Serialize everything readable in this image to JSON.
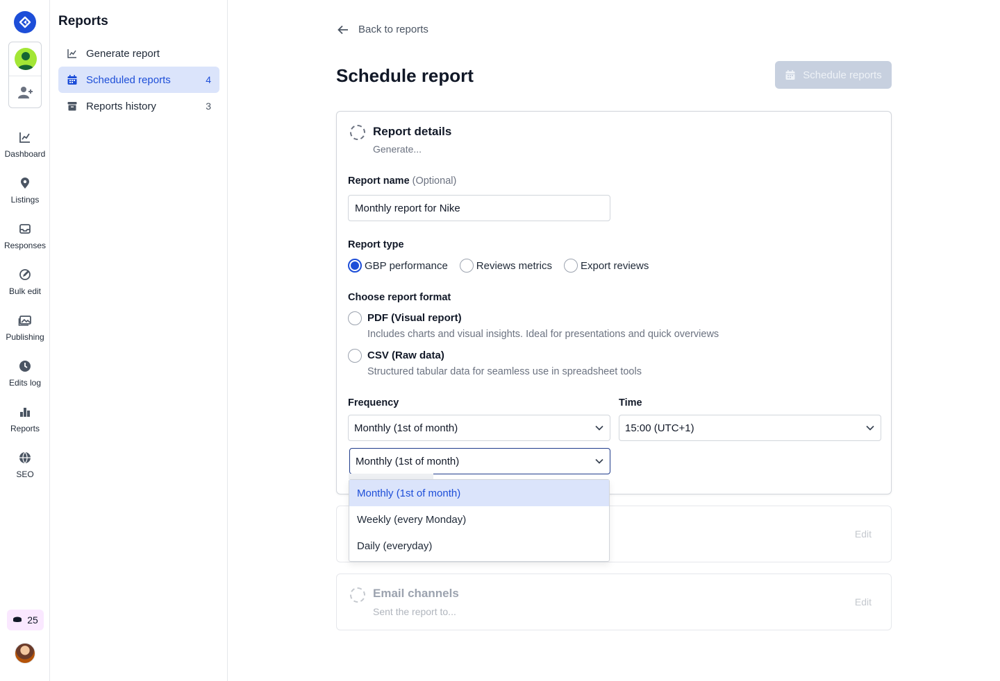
{
  "rail": {
    "items": [
      {
        "label": "Dashboard",
        "icon": "chart-line-icon"
      },
      {
        "label": "Listings",
        "icon": "map-pin-icon"
      },
      {
        "label": "Responses",
        "icon": "inbox-icon"
      },
      {
        "label": "Bulk edit",
        "icon": "edit-circle-icon"
      },
      {
        "label": "Publishing",
        "icon": "images-icon"
      },
      {
        "label": "Edits log",
        "icon": "clock-icon"
      },
      {
        "label": "Reports",
        "icon": "bar-chart-icon"
      },
      {
        "label": "SEO",
        "icon": "globe-icon"
      }
    ],
    "credits": "25"
  },
  "subnav": {
    "title": "Reports",
    "items": [
      {
        "label": "Generate report",
        "count": "",
        "icon": "chart-line-icon"
      },
      {
        "label": "Scheduled reports",
        "count": "4",
        "icon": "calendar-icon"
      },
      {
        "label": "Reports history",
        "count": "3",
        "icon": "archive-icon"
      }
    ]
  },
  "header": {
    "back_label": "Back to reports",
    "title": "Schedule report",
    "schedule_button": "Schedule reports"
  },
  "details": {
    "title": "Report details",
    "subtitle": "Generate...",
    "name_label": "Report name",
    "name_optional": "(Optional)",
    "name_value": "Monthly report for Nike",
    "type_label": "Report type",
    "types": [
      "GBP performance",
      "Reviews metrics",
      "Export reviews"
    ],
    "selected_type": "GBP performance",
    "format_label": "Choose report format",
    "formats": [
      {
        "title": "PDF (Visual report)",
        "desc": "Includes charts and visual insights. Ideal for presentations and quick overviews"
      },
      {
        "title": "CSV (Raw data)",
        "desc": "Structured tabular data for seamless use in spreadsheet tools"
      }
    ],
    "frequency_label": "Frequency",
    "frequency_value": "Monthly (1st of month)",
    "time_label": "Time",
    "time_value": "15:00 (UTC+1)",
    "frequency_open_value": "Monthly (1st of month)",
    "frequency_options": [
      "Monthly (1st of month)",
      "Weekly (every Monday)",
      "Daily (everyday)"
    ]
  },
  "section2": {
    "edit": "Edit"
  },
  "email": {
    "title": "Email channels",
    "subtitle": "Sent the report to...",
    "edit": "Edit"
  },
  "colors": {
    "accent": "#1d4ed8",
    "active_bg": "#dbe4fb",
    "disabled_button": "#c7d0df"
  }
}
